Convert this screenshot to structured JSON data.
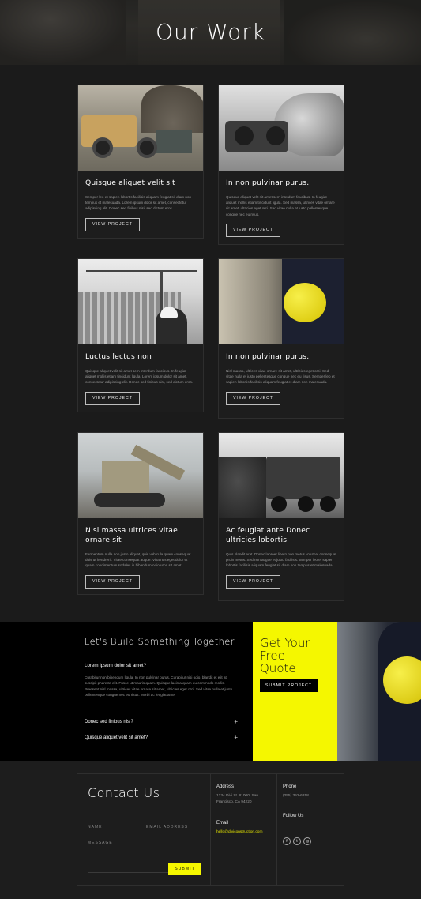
{
  "hero": {
    "title": "Our Work"
  },
  "projects": [
    {
      "title": "Quisque aliquet velit sit",
      "body": "Semper leo et sapien lobortis facilisis aliquam feugiat sit diam non tempus et malesuada. Lorem ipsum dolor sit amet, consectetur adipiscing elit. Donec sed finibus nisi, sed dictum eros.",
      "button": "VIEW PROJECT"
    },
    {
      "title": "In non pulvinar purus.",
      "body": "Quisque aliquet velit sit amet sem interdum faucibus. In feugiat aliquet mollis etiam tincidunt ligula. Sed massa, ultrices vitae ornare sit amet, ultricies eget orci. Sed vitae nulla et justo pellentesque congue nec eu risus.",
      "button": "VIEW PROJECT"
    },
    {
      "title": "Luctus lectus non",
      "body": "Quisque aliquet velit sit amet sem interdum faucibus. In feugiat aliquet mollis etiam tincidunt ligula. Lorem ipsum dolor sit amet, consectetur adipiscing elit. Donec sed finibus nisi, sed dictum eros.",
      "button": "VIEW PROJECT"
    },
    {
      "title": "In non pulvinar purus.",
      "body": "Nisl massa, ultrices vitae ornare sit amet, ultricies eget orci. Sed vitae nulla et justo pellentesque congue nec eu risus. Semper leo et sapien lobortis facilisis aliquam feugiat et diam non malesuada.",
      "button": "VIEW PROJECT"
    },
    {
      "title": "Nisl massa ultrices vitae ornare sit",
      "body": "Fermentum nulla non justo aliquet, quis vehicula quam consequat duis ut hendrerit. Vitae consequat augue. Vivamus eget dolor et quam condimentum sodales in bibendum odio urna sit amet.",
      "button": "VIEW PROJECT"
    },
    {
      "title": "Ac feugiat ante Donec ultricies lobortis",
      "body": "Quis blandit erat. Donec laoreet libero non metus volutpat consequat proin metus. Sed non augue et justo facilisis. Semper leo et sapien lobortis facilisis aliquam feugiat sit diam non tempus et malesuada.",
      "button": "VIEW PROJECT"
    }
  ],
  "cta": {
    "heading": "Let's Build Something Together",
    "question": "Lorem ipsum dolor sit amet?",
    "answer": "Curabitur non bibendum ligula. In non pulvinar purus. Curabitur nisi odio, blandit et elit at, suscipit pharetra elit. Fusce ut mauris quam. Quisque lacinia quam eu commodo mollis. Praesent nisl massa, ultrices vitae ornare sit amet, ultricies eget orci. Sed vitae nulla et justo pellentesque congue nec eu risus. Morbi ac feugiat ante.",
    "accordion": [
      "Donec sed finibus nisi?",
      "Quisque aliquet velit sit amet?"
    ],
    "quote_heading": "Get Your Free Quote",
    "quote_button": "SUBMIT PROJECT",
    "accent_color": "#f5f700"
  },
  "contact": {
    "heading": "Contact Us",
    "name_placeholder": "NAME",
    "email_placeholder": "EMAIL ADDRESS",
    "message_placeholder": "MESSAGE",
    "submit": "SUBMIT",
    "address_label": "Address",
    "address": "1234 Divi St. #1000, San Francisco, CA 94220",
    "email_label": "Email",
    "email": "hello@diviconstruction.com",
    "phone_label": "Phone",
    "phone": "(255) 352-6258",
    "follow_label": "Follow Us",
    "social": [
      "f",
      "t",
      "ig"
    ]
  }
}
